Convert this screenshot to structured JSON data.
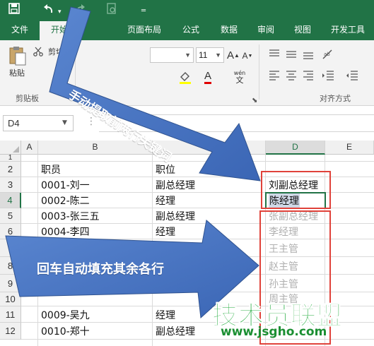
{
  "quick_access": {
    "save_icon": "save-icon",
    "undo_icon": "undo-icon",
    "redo_icon": "redo-icon",
    "customize_icon": "customize-icon"
  },
  "tabs": [
    {
      "label": "文件",
      "active": false
    },
    {
      "label": "开始",
      "active": true
    },
    {
      "label": "页面布局",
      "active": false
    },
    {
      "label": "公式",
      "active": false
    },
    {
      "label": "数据",
      "active": false
    },
    {
      "label": "审阅",
      "active": false
    },
    {
      "label": "视图",
      "active": false
    },
    {
      "label": "开发工具",
      "active": false
    }
  ],
  "ribbon": {
    "clipboard": {
      "cut_label": "剪切",
      "paste_label": "粘贴",
      "group_label": "剪贴板"
    },
    "font": {
      "size_value": "11",
      "wen_label": "wén",
      "wen_sub": "文"
    },
    "alignment": {
      "group_label": "对齐方式"
    }
  },
  "formula_bar": {
    "name_box": "D4"
  },
  "sheet": {
    "columns": [
      "A",
      "B",
      "C",
      "D",
      "E"
    ],
    "selected_column": "D",
    "rows": [
      {
        "num": "1",
        "b": "",
        "c": "",
        "d": ""
      },
      {
        "num": "2",
        "b": "职员",
        "c": "职位",
        "d": ""
      },
      {
        "num": "3",
        "b": "0001-刘一",
        "c": "副总经理",
        "d": "刘副总经理"
      },
      {
        "num": "4",
        "b": "0002-陈二",
        "c": "经理",
        "d": "陈经理"
      },
      {
        "num": "5",
        "b": "0003-张三五",
        "c": "副总经理",
        "d": "张副总经理"
      },
      {
        "num": "6",
        "b": "0004-李四",
        "c": "经理",
        "d": "李经理"
      },
      {
        "num": "7",
        "b": "",
        "c": "",
        "d": "王主管"
      },
      {
        "num": "8",
        "b": "",
        "c": "",
        "d": "赵主管"
      },
      {
        "num": "9",
        "b": "",
        "c": "",
        "d": "孙主管"
      },
      {
        "num": "10",
        "b": "",
        "c": "",
        "d": "周主管"
      },
      {
        "num": "11",
        "b": "0009-吴九",
        "c": "经理",
        "d": ""
      },
      {
        "num": "12",
        "b": "0010-郑十",
        "c": "副总经理",
        "d": ""
      }
    ],
    "selected_row": "4"
  },
  "annotations": {
    "arrow1_text": "手动提取前两行关键词",
    "arrow2_text": "回车自动填充其余各行"
  },
  "watermark": {
    "title": "技术员联盟",
    "url": "www.jsgho.com"
  },
  "colors": {
    "excel_green": "#217346",
    "arrow_blue": "#4472c4",
    "highlight_red": "#e0423a"
  }
}
